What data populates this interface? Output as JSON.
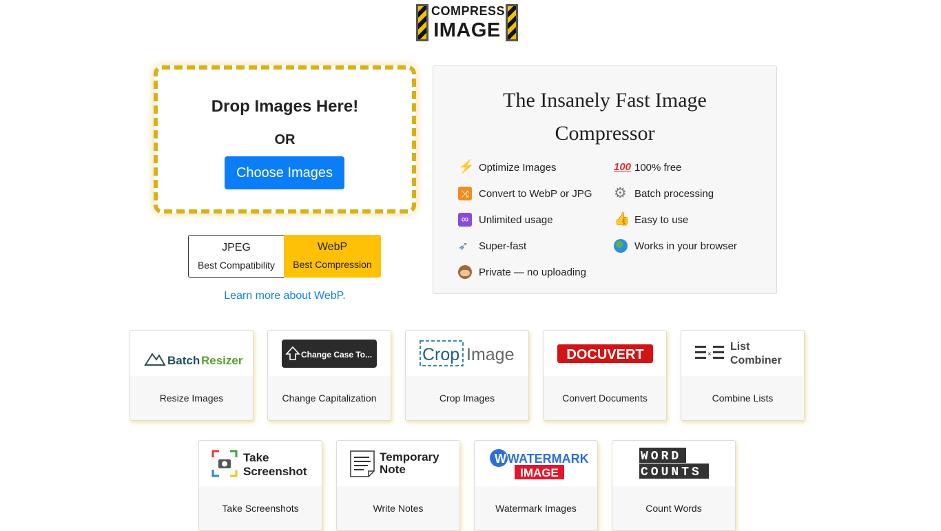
{
  "logo": {
    "line1": "COMPRESS",
    "line2": "IMAGE"
  },
  "upload": {
    "title": "Drop Images Here!",
    "or_text": "OR",
    "button_label": "Choose Images"
  },
  "formats": {
    "jpeg": {
      "name": "JPEG",
      "desc": "Best Compatibility"
    },
    "webp": {
      "name": "WebP",
      "desc": "Best Compression",
      "selected": true
    }
  },
  "learn_more": "Learn more about WebP.",
  "info": {
    "title_line1": "The Insanely Fast Image",
    "title_line2": "Compressor",
    "features": [
      {
        "icon": "lightning-icon",
        "text": "Optimize Images"
      },
      {
        "icon": "hundred-points-icon",
        "text": "100% free"
      },
      {
        "icon": "shuffle-icon",
        "text": "Convert to WebP or JPG"
      },
      {
        "icon": "gear-icon",
        "text": "Batch processing"
      },
      {
        "icon": "infinity-icon",
        "text": "Unlimited usage"
      },
      {
        "icon": "thumbs-up-icon",
        "text": "Easy to use"
      },
      {
        "icon": "rocket-icon",
        "text": "Super-fast"
      },
      {
        "icon": "globe-icon",
        "text": "Works in your browser"
      },
      {
        "icon": "see-no-evil-monkey-icon",
        "text": "Private — no uploading"
      }
    ]
  },
  "tools": [
    {
      "logo_text_a": "Batch",
      "logo_text_b": "Resizer",
      "label": "Resize Images"
    },
    {
      "logo_text": "Change Case To...",
      "label": "Change Capitalization"
    },
    {
      "logo_text_a": "Crop",
      "logo_text_b": "Image",
      "label": "Crop Images"
    },
    {
      "logo_text": "DOCUVERT",
      "label": "Convert Documents"
    },
    {
      "logo_text_a": "List",
      "logo_text_b": "Combiner",
      "label": "Combine Lists"
    },
    {
      "logo_text_a": "Take",
      "logo_text_b": "Screenshot",
      "label": "Take Screenshots"
    },
    {
      "logo_text_a": "Temporary",
      "logo_text_b": "Note",
      "label": "Write Notes"
    },
    {
      "logo_text_a": "WATERMARK",
      "logo_text_b": "IMAGE",
      "label": "Watermark Images"
    },
    {
      "logo_text_a": "WORD",
      "logo_text_b": "COUNTS",
      "label": "Count Words"
    }
  ],
  "colors": {
    "accent_blue": "#0b7ef7",
    "accent_yellow": "#ffc107",
    "dropzone_border": "#d9b017"
  }
}
